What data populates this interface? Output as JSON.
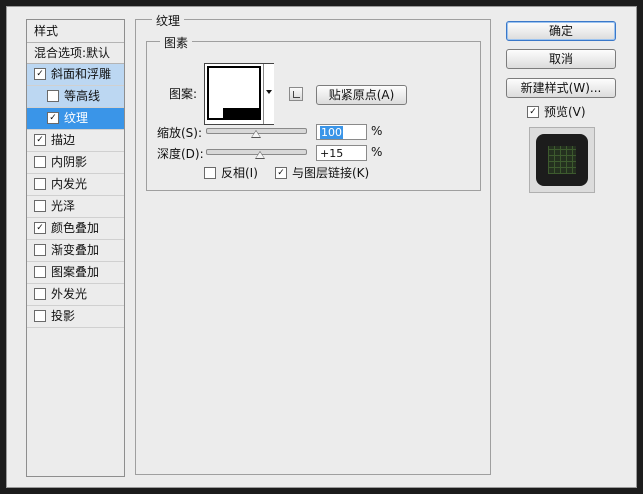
{
  "styles": {
    "header": "样式",
    "blend_options": "混合选项:默认",
    "items": [
      {
        "label": "斜面和浮雕",
        "checked": true
      },
      {
        "label": "等高线",
        "checked": false
      },
      {
        "label": "纹理",
        "checked": true
      },
      {
        "label": "描边",
        "checked": true
      },
      {
        "label": "内阴影",
        "checked": false
      },
      {
        "label": "内发光",
        "checked": false
      },
      {
        "label": "光泽",
        "checked": false
      },
      {
        "label": "颜色叠加",
        "checked": true
      },
      {
        "label": "渐变叠加",
        "checked": false
      },
      {
        "label": "图案叠加",
        "checked": false
      },
      {
        "label": "外发光",
        "checked": false
      },
      {
        "label": "投影",
        "checked": false
      }
    ]
  },
  "texture": {
    "panel_title": "纹理",
    "group_title": "图素",
    "pattern_label": "图案:",
    "snap_button": "贴紧原点(A)",
    "scale_label": "缩放(S):",
    "scale_value": "100",
    "scale_unit": "%",
    "depth_label": "深度(D):",
    "depth_value": "+15",
    "depth_unit": "%",
    "invert_label": "反相(I)",
    "invert_checked": false,
    "link_label": "与图层链接(K)",
    "link_checked": true
  },
  "actions": {
    "ok": "确定",
    "cancel": "取消",
    "new_style": "新建样式(W)...",
    "preview_label": "预览(V)",
    "preview_checked": true
  },
  "check_glyph": "✓"
}
